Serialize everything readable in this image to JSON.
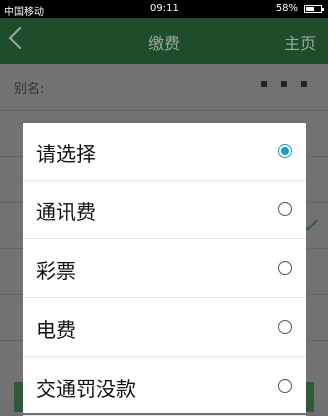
{
  "status_bar": {
    "carrier": "中国移动",
    "time": "09:11",
    "battery": "58%",
    "battery_level": 0.58
  },
  "navbar": {
    "title": "缴费",
    "home_label": "主页"
  },
  "background_form": {
    "name_label": "别名:",
    "name_value": "▪ ▪ ▪"
  },
  "dialog": {
    "options": [
      {
        "label": "请选择",
        "selected": true
      },
      {
        "label": "通讯费",
        "selected": false
      },
      {
        "label": "彩票",
        "selected": false
      },
      {
        "label": "电费",
        "selected": false
      },
      {
        "label": "交通罚没款",
        "selected": false
      }
    ]
  }
}
